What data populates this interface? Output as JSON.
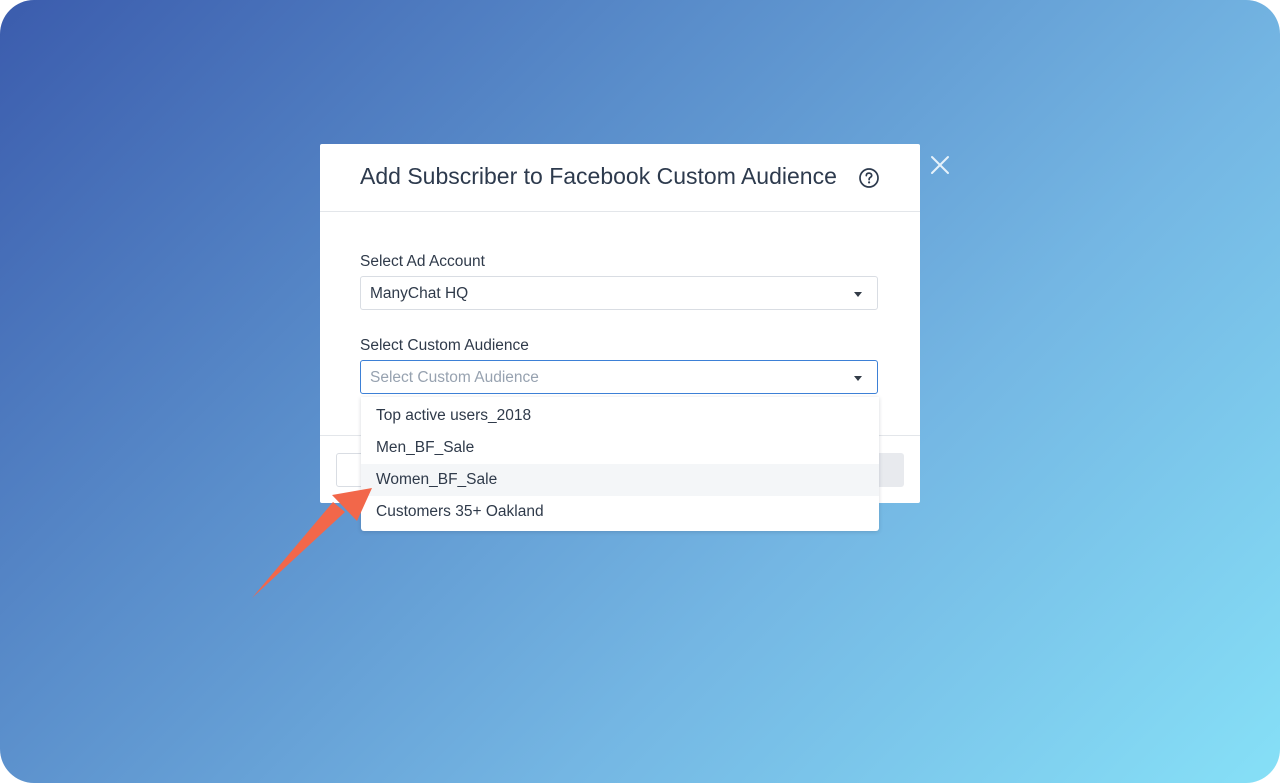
{
  "modal": {
    "title": "Add Subscriber to Facebook Custom Audience",
    "help_icon": "question-circle-icon",
    "close_icon": "close-x-icon"
  },
  "ad_account": {
    "label": "Select Ad Account",
    "value": "ManyChat HQ"
  },
  "custom_audience": {
    "label": "Select Custom Audience",
    "placeholder": "Select Custom Audience",
    "options": [
      "Top active users_2018",
      "Men_BF_Sale",
      "Women_BF_Sale",
      "Customers 35+ Oakland"
    ],
    "highlighted_option": "Women_BF_Sale"
  },
  "colors": {
    "focus_border": "#3d80d6",
    "annotation_arrow": "#f2674a"
  }
}
